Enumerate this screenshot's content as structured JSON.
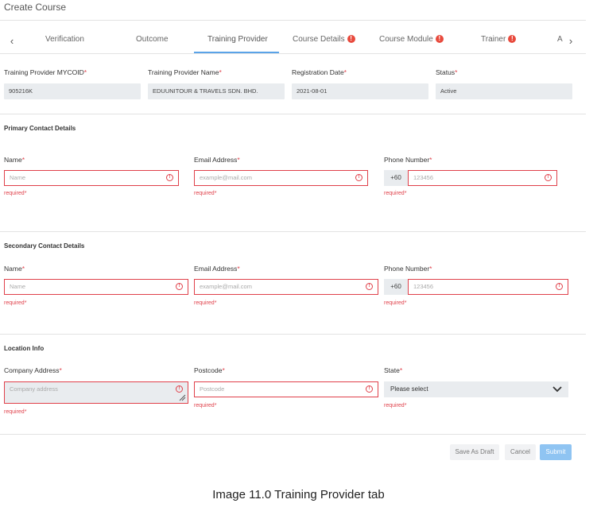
{
  "page": {
    "title": "Create Course"
  },
  "tabs": {
    "prev_icon": "chevron-left-icon",
    "next_icon": "chevron-right-icon",
    "items": [
      {
        "label": "Verification",
        "error": false
      },
      {
        "label": "Outcome",
        "error": false
      },
      {
        "label": "Training Provider",
        "error": false,
        "active": true
      },
      {
        "label": "Course Details",
        "error": true
      },
      {
        "label": "Course Module",
        "error": true
      },
      {
        "label": "Trainer",
        "error": true
      },
      {
        "label": "A",
        "error": false
      }
    ]
  },
  "provider": {
    "mycoid": {
      "label": "Training Provider MYCOID",
      "value": "905216K"
    },
    "name": {
      "label": "Training Provider Name",
      "value": "EDUUNITOUR & TRAVELS SDN. BHD."
    },
    "reg_date": {
      "label": "Registration Date",
      "value": "2021-08-01"
    },
    "status": {
      "label": "Status",
      "value": "Active"
    }
  },
  "primary": {
    "title": "Primary Contact Details",
    "name": {
      "label": "Name",
      "placeholder": "Name"
    },
    "email": {
      "label": "Email Address",
      "placeholder": "example@mail.com"
    },
    "phone": {
      "label": "Phone Number",
      "prefix": "+60",
      "placeholder": "123456"
    }
  },
  "secondary": {
    "title": "Secondary Contact Details",
    "name": {
      "label": "Name",
      "placeholder": "Name"
    },
    "email": {
      "label": "Email Address",
      "placeholder": "example@mail.com"
    },
    "phone": {
      "label": "Phone Number",
      "prefix": "+60",
      "placeholder": "123456"
    }
  },
  "location": {
    "title": "Location Info",
    "address": {
      "label": "Company Address",
      "placeholder": "Company address"
    },
    "postcode": {
      "label": "Postcode",
      "placeholder": "Postcode"
    },
    "state": {
      "label": "State",
      "value": "Please select"
    }
  },
  "validation": {
    "required_text": "required",
    "asterisk": "*",
    "alert_glyph": "!"
  },
  "actions": {
    "draft": "Save As Draft",
    "cancel": "Cancel",
    "submit": "Submit"
  },
  "caption": "Image 11.0 Training Provider tab",
  "colors": {
    "accent": "#5aa3e8",
    "error": "#e0404a",
    "submit": "#8fc4f2",
    "readonly_bg": "#e9ecef"
  }
}
